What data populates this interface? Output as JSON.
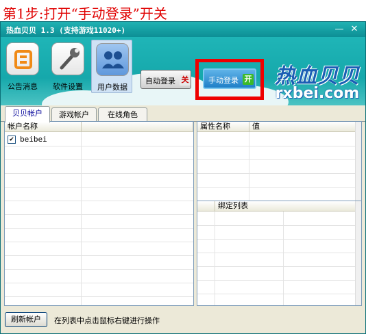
{
  "caption": "第1步:打开“手动登录”开关",
  "window": {
    "title": "热血贝贝 1.3  (支持游戏11020+)",
    "minimize_glyph": "—",
    "close_glyph": "✕"
  },
  "toolbar": {
    "notice_label": "公告消息",
    "settings_label": "软件设置",
    "userdata_label": "用户数据",
    "auto_login_label": "自动登录",
    "auto_login_state": "关",
    "manual_login_label": "手动登录",
    "manual_login_state": "开"
  },
  "logo": {
    "cn": "热血贝贝",
    "en": "rxbei.com"
  },
  "tabs": [
    {
      "label": "贝贝帐户",
      "active": true
    },
    {
      "label": "游戏帐户",
      "active": false
    },
    {
      "label": "在线角色",
      "active": false
    }
  ],
  "accounts_table": {
    "columns": [
      "帐户名称",
      ""
    ],
    "rows": [
      {
        "checked": true,
        "check_glyph": "✔",
        "name": "beibei"
      }
    ]
  },
  "attributes_table": {
    "columns": [
      "属性名称",
      "值"
    ]
  },
  "bind_table": {
    "columns": [
      "",
      "绑定列表"
    ]
  },
  "footer": {
    "refresh_label": "刷新帐户",
    "hint": "在列表中点击鼠标右键进行操作"
  },
  "colors": {
    "title_bar": "#0d8f95",
    "toolbar": "#16a8ab",
    "highlight": "#ee0000",
    "logo_blue": "#1a5fb4",
    "toggle_on": "#3cba2b",
    "toggle_off": "#cc0000"
  }
}
